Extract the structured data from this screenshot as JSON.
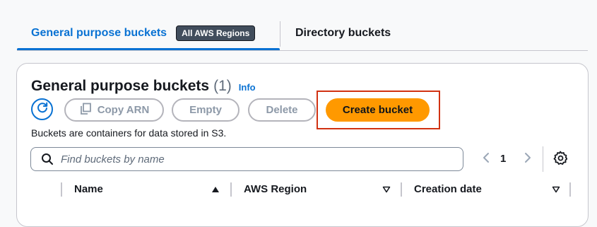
{
  "tabs": {
    "general_label": "General purpose buckets",
    "general_badge": "All AWS Regions",
    "directory_label": "Directory buckets"
  },
  "card": {
    "title": "General purpose buckets",
    "count": "(1)",
    "info": "Info",
    "description": "Buckets are containers for data stored in S3."
  },
  "actions": {
    "copy_arn": "Copy ARN",
    "empty": "Empty",
    "delete": "Delete",
    "create": "Create bucket"
  },
  "search": {
    "placeholder": "Find buckets by name",
    "value": ""
  },
  "pagination": {
    "current_page": "1"
  },
  "table": {
    "columns": [
      "Name",
      "AWS Region",
      "Creation date"
    ]
  },
  "icons": {
    "refresh": "refresh-icon",
    "copy": "copy-icon",
    "search": "search-icon",
    "prev": "chevron-left-icon",
    "next": "chevron-right-icon",
    "settings": "gear-icon",
    "sort_asc": "sort-ascending-icon",
    "sort_desc": "sort-descending-icon"
  },
  "colors": {
    "accent": "#0972d3",
    "primary_button": "#ff9900",
    "highlight": "#d13212",
    "badge": "#414d5c"
  }
}
